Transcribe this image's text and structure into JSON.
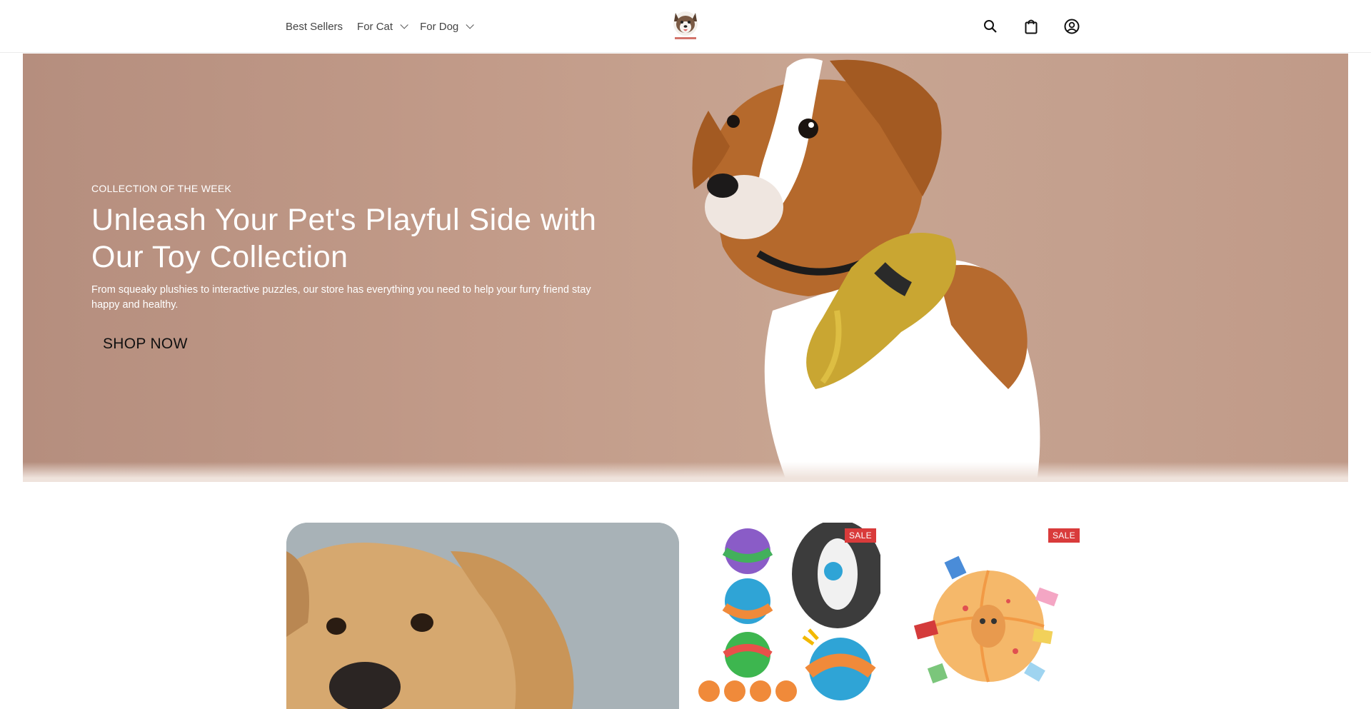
{
  "nav": {
    "items": [
      {
        "label": "Best Sellers",
        "has_dropdown": false
      },
      {
        "label": "For Cat",
        "has_dropdown": true
      },
      {
        "label": "For Dog",
        "has_dropdown": true
      }
    ]
  },
  "logo": {
    "icon": "husky-logo-icon"
  },
  "header_icons": [
    "search-icon",
    "shopping-bag-icon",
    "account-icon"
  ],
  "hero": {
    "eyebrow": "COLLECTION OF THE WEEK",
    "title": "Unleash Your Pet's Playful Side with Our Toy Collection",
    "description": "From squeaky plushies to interactive puzzles, our store has everything you need to help your furry friend stay happy and healthy.",
    "cta_label": "SHOP NOW"
  },
  "products": [
    {
      "badge": "SALE"
    },
    {
      "badge": "SALE"
    }
  ],
  "colors": {
    "sale_badge": "#d93b3b",
    "hero_bg": "#c29b89"
  }
}
